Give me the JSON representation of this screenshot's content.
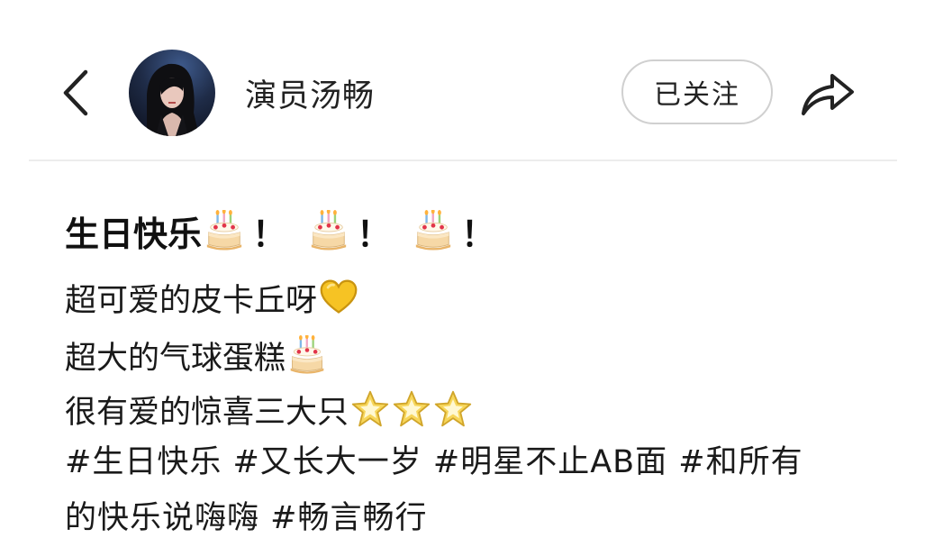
{
  "header": {
    "username": "演员汤畅",
    "follow_label": "已关注"
  },
  "post": {
    "title_text": "生日快乐",
    "title_excl": [
      "！",
      "！",
      "！"
    ],
    "lines": [
      "超可爱的皮卡丘呀",
      "超大的气球蛋糕",
      "很有爱的惊喜三大只"
    ],
    "hashtags_line1": "#生日快乐 #又长大一岁 #明星不止AB面 #和所有",
    "hashtags_line2": "的快乐说嗨嗨 #畅言畅行"
  },
  "icons": {
    "back": "chevron-left-icon",
    "share": "share-arrow-icon",
    "cake": "birthday-cake-emoji",
    "heart": "yellow-heart-emoji",
    "star": "glowing-star-emoji"
  },
  "colors": {
    "heart": "#f6c324",
    "star": "#f4c842",
    "cake_cream": "#fdf1dc",
    "divider": "#ececec",
    "follow_border": "#d0d0d0"
  }
}
